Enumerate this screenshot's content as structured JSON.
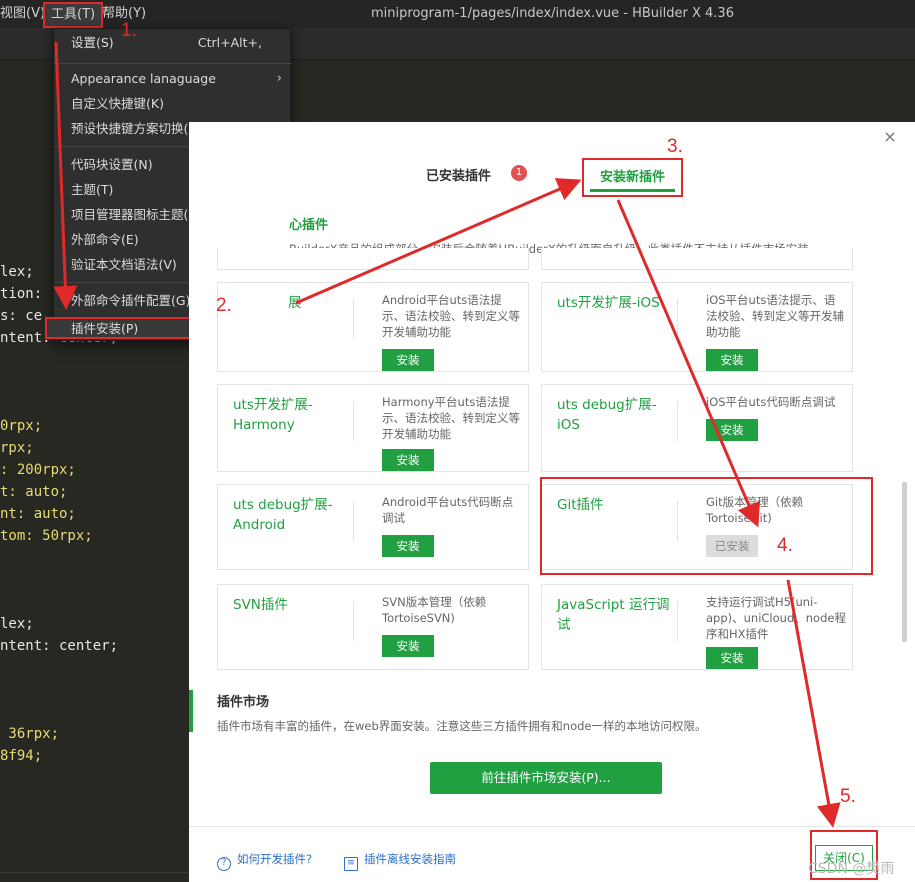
{
  "window": {
    "menu_view": "视图(V)",
    "menu_tools": "工具(T)",
    "menu_help": "帮助(Y)",
    "title": "miniprogram-1/pages/index/index.vue - HBuilder X 4.36"
  },
  "tools_menu": {
    "settings": "设置(S)",
    "settings_shortcut": "Ctrl+Alt+,",
    "appearance": "Appearance lanaguage",
    "custom_shortcuts": "自定义快捷键(K)",
    "shortcut_scheme": "预设快捷键方案切换(W)",
    "snippet_settings": "代码块设置(N)",
    "theme": "主题(T)",
    "project_icon_theme": "项目管理器图标主题(I)",
    "external_commands": "外部命令(E)",
    "validate_doc": "验证本文档语法(V)",
    "ext_cmd_plugin_config": "外部命令插件配置(G)",
    "plugin_install": "插件安装(P)"
  },
  "code_lines": [
    "lex;",
    "tion:",
    "s: ce",
    "ntent: center;",
    "0rpx;",
    "rpx;",
    ": 200rpx;",
    "t: auto;",
    "nt: auto;",
    "tom: 50rpx;",
    "lex;",
    "ntent: center;",
    " 36rpx;",
    "8f94;"
  ],
  "dialog": {
    "close": "×",
    "tab_installed": "已安装插件",
    "tab_installed_badge": "1",
    "tab_new": "安装新插件",
    "core_title": "心插件",
    "core_desc": "BuilderX产品的组成部分，安装后会随着HBuilderX的升级而自升级，此类插件不支持从插件市场安装。",
    "plugins": [
      {
        "name": "展",
        "desc": "Android平台uts语法提示、语法校验、转到定义等开发辅助功能",
        "button": "安装"
      },
      {
        "name": "uts开发扩展-iOS",
        "desc": "iOS平台uts语法提示、语法校验、转到定义等开发辅助功能",
        "button": "安装"
      },
      {
        "name": "uts开发扩展-Harmony",
        "desc": "Harmony平台uts语法提示、语法校验、转到定义等开发辅助功能",
        "button": "安装"
      },
      {
        "name": "uts debug扩展-iOS",
        "desc": "iOS平台uts代码断点调试",
        "button": "安装"
      },
      {
        "name": "uts debug扩展-Android",
        "desc": "Android平台uts代码断点调试",
        "button": "安装"
      },
      {
        "name": "Git插件",
        "desc": "Git版本管理（依赖TortoiseGit)",
        "button": "已安装"
      },
      {
        "name": "SVN插件",
        "desc": "SVN版本管理（依赖TortoiseSVN)",
        "button": "安装"
      },
      {
        "name": "JavaScript 运行调试",
        "desc": "支持运行调试H5(uni-app)、uniCloud、node程序和HX插件",
        "button": "安装"
      }
    ],
    "market_title": "插件市场",
    "market_desc": "插件市场有丰富的插件，在web界面安装。注意这些三方插件拥有和node一样的本地访问权限。",
    "market_button": "前往插件市场安装(P)...",
    "footer_link_dev": "如何开发插件?",
    "footer_link_offline": "插件离线安装指南",
    "close_button": "关闭(C)"
  },
  "annotations": {
    "step1": "1.",
    "step2": "2.",
    "step3": "3.",
    "step4": "4.",
    "step5": "5."
  },
  "watermark": "CSDN @樊雨",
  "colors": {
    "accent_green": "#21a041",
    "annotation_red": "#e02a2a",
    "editor_bg": "#272822",
    "code_yellow": "#e6db74"
  }
}
